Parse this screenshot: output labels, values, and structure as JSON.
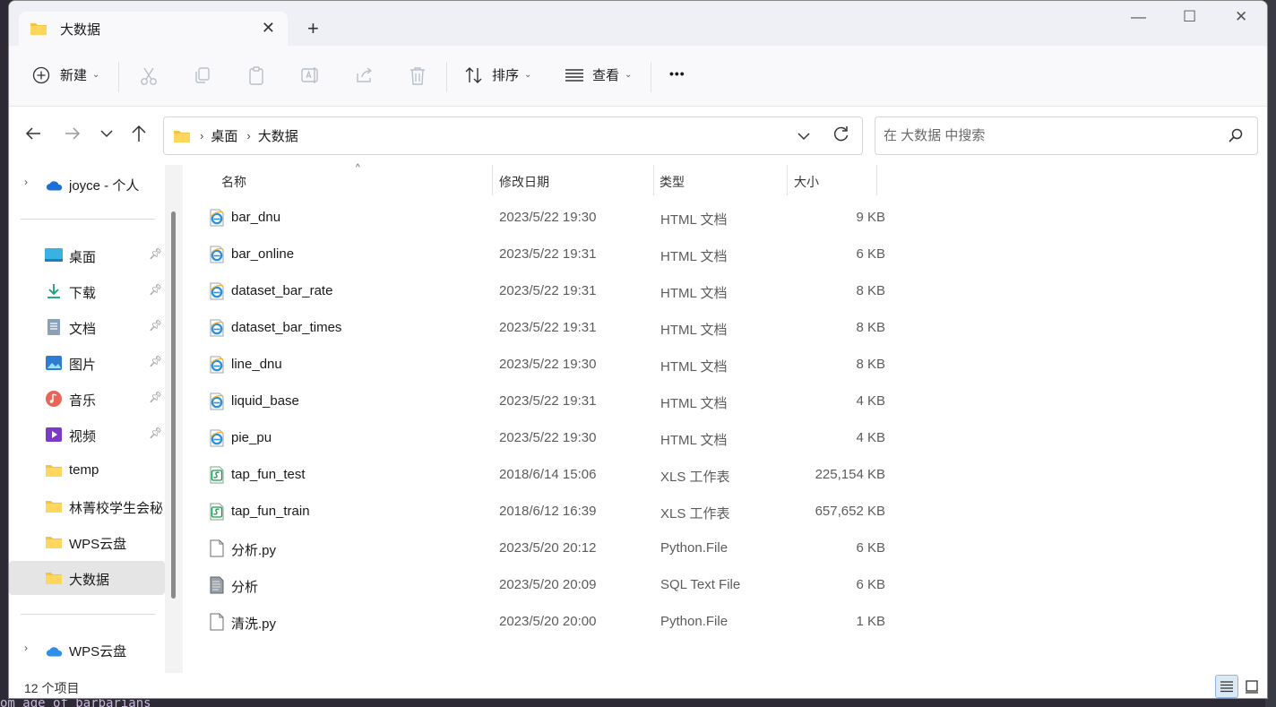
{
  "window": {
    "tab_title": "大数据",
    "new_tab_label": "+",
    "minimize": "—",
    "maximize": "☐",
    "close": "✕"
  },
  "toolbar": {
    "new_label": "新建",
    "sort_label": "排序",
    "view_label": "查看",
    "more_label": "•••"
  },
  "address": {
    "crumbs": [
      "桌面",
      "大数据"
    ],
    "search_placeholder": "在 大数据 中搜索"
  },
  "sidebar": {
    "onedrive_label": "joyce - 个人",
    "items": [
      {
        "label": "桌面",
        "icon": "desktop-icon",
        "pinned": true
      },
      {
        "label": "下载",
        "icon": "download-icon",
        "pinned": true
      },
      {
        "label": "文档",
        "icon": "document-icon",
        "pinned": true
      },
      {
        "label": "图片",
        "icon": "pictures-icon",
        "pinned": true
      },
      {
        "label": "音乐",
        "icon": "music-icon",
        "pinned": true
      },
      {
        "label": "视频",
        "icon": "video-icon",
        "pinned": true
      },
      {
        "label": "temp",
        "icon": "folder-icon",
        "pinned": false
      },
      {
        "label": "林菁校学生会秘",
        "icon": "folder-icon",
        "pinned": false
      },
      {
        "label": "WPS云盘",
        "icon": "folder-icon",
        "pinned": false
      },
      {
        "label": "大数据",
        "icon": "folder-icon",
        "pinned": false,
        "selected": true
      }
    ],
    "wps_cloud_label": "WPS云盘"
  },
  "columns": {
    "name": "名称",
    "date": "修改日期",
    "type": "类型",
    "size": "大小"
  },
  "files": [
    {
      "name": "bar_dnu",
      "date": "2023/5/22 19:30",
      "type": "HTML 文档",
      "size": "9 KB",
      "icon": "html-icon"
    },
    {
      "name": "bar_online",
      "date": "2023/5/22 19:31",
      "type": "HTML 文档",
      "size": "6 KB",
      "icon": "html-icon"
    },
    {
      "name": "dataset_bar_rate",
      "date": "2023/5/22 19:31",
      "type": "HTML 文档",
      "size": "8 KB",
      "icon": "html-icon"
    },
    {
      "name": "dataset_bar_times",
      "date": "2023/5/22 19:31",
      "type": "HTML 文档",
      "size": "8 KB",
      "icon": "html-icon"
    },
    {
      "name": "line_dnu",
      "date": "2023/5/22 19:30",
      "type": "HTML 文档",
      "size": "8 KB",
      "icon": "html-icon"
    },
    {
      "name": "liquid_base",
      "date": "2023/5/22 19:31",
      "type": "HTML 文档",
      "size": "4 KB",
      "icon": "html-icon"
    },
    {
      "name": "pie_pu",
      "date": "2023/5/22 19:30",
      "type": "HTML 文档",
      "size": "4 KB",
      "icon": "html-icon"
    },
    {
      "name": "tap_fun_test",
      "date": "2018/6/14 15:06",
      "type": "XLS 工作表",
      "size": "225,154 KB",
      "icon": "xls-icon"
    },
    {
      "name": "tap_fun_train",
      "date": "2018/6/12 16:39",
      "type": "XLS 工作表",
      "size": "657,652 KB",
      "icon": "xls-icon"
    },
    {
      "name": "分析.py",
      "date": "2023/5/20 20:12",
      "type": "Python.File",
      "size": "6 KB",
      "icon": "file-icon"
    },
    {
      "name": "分析",
      "date": "2023/5/20 20:09",
      "type": "SQL Text File",
      "size": "6 KB",
      "icon": "sql-file-icon"
    },
    {
      "name": "清洗.py",
      "date": "2023/5/20 20:00",
      "type": "Python.File",
      "size": "1 KB",
      "icon": "file-icon"
    }
  ],
  "status": {
    "item_count": "12 个项目"
  },
  "background": {
    "editor_text": "om age of barbarians"
  }
}
